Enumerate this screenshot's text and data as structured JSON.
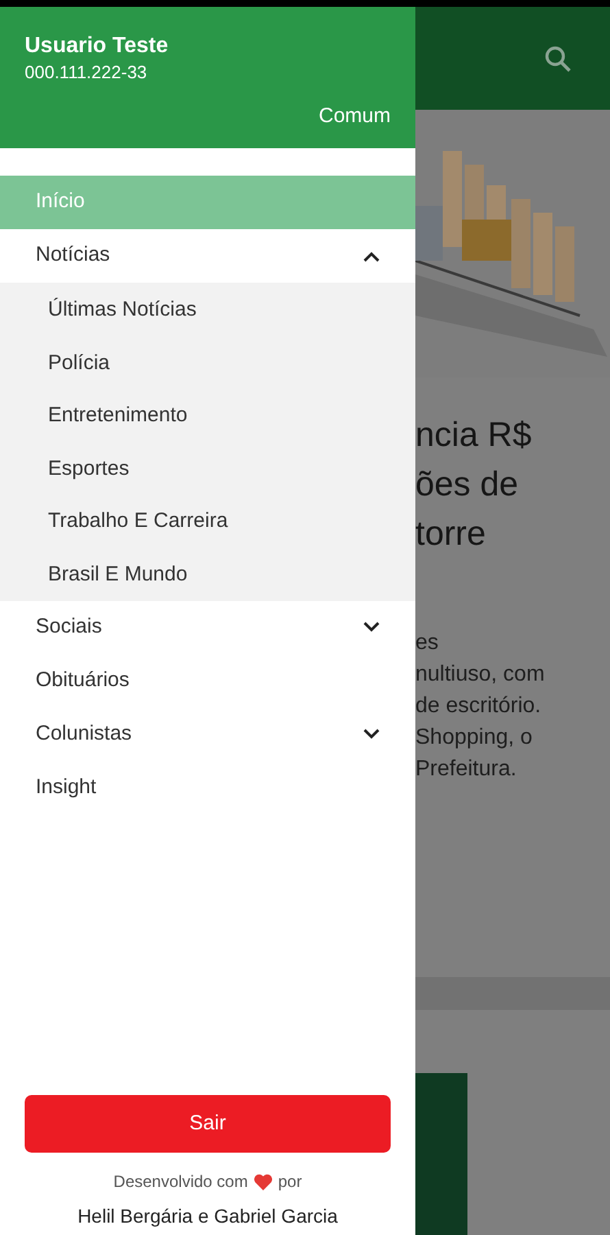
{
  "background_page": {
    "headline_lines": [
      "ncia R$",
      "ões de",
      "torre"
    ],
    "body_lines": [
      "es",
      "nultiuso, com",
      "de escritório.",
      "Shopping, o",
      "Prefeitura."
    ]
  },
  "drawer": {
    "user": {
      "name": "Usuario Teste",
      "document": "000.111.222-33",
      "profile": "Comum"
    },
    "menu": [
      {
        "label": "Início",
        "kind": "link",
        "selected": true
      },
      {
        "label": "Notícias",
        "kind": "group",
        "selected": false,
        "expanded": true,
        "children": [
          {
            "label": "Últimas Notícias",
            "selected": false
          },
          {
            "label": "Polícia",
            "selected": false
          },
          {
            "label": "Entretenimento",
            "selected": false
          },
          {
            "label": "Esportes",
            "selected": false
          },
          {
            "label": "Trabalho E Carreira",
            "selected": false
          },
          {
            "label": "Brasil E Mundo",
            "selected": false
          }
        ]
      },
      {
        "label": "Sociais",
        "kind": "group",
        "selected": false,
        "expanded": false
      },
      {
        "label": "Obituários",
        "kind": "link",
        "selected": false
      },
      {
        "label": "Colunistas",
        "kind": "group",
        "selected": false,
        "expanded": false
      },
      {
        "label": "Insight",
        "kind": "link",
        "selected": false
      }
    ],
    "logout_button": "Sair",
    "credits": {
      "before": "Desenvolvido com",
      "after": "por",
      "authors": "Helil Bergária e Gabriel Garcia"
    }
  }
}
